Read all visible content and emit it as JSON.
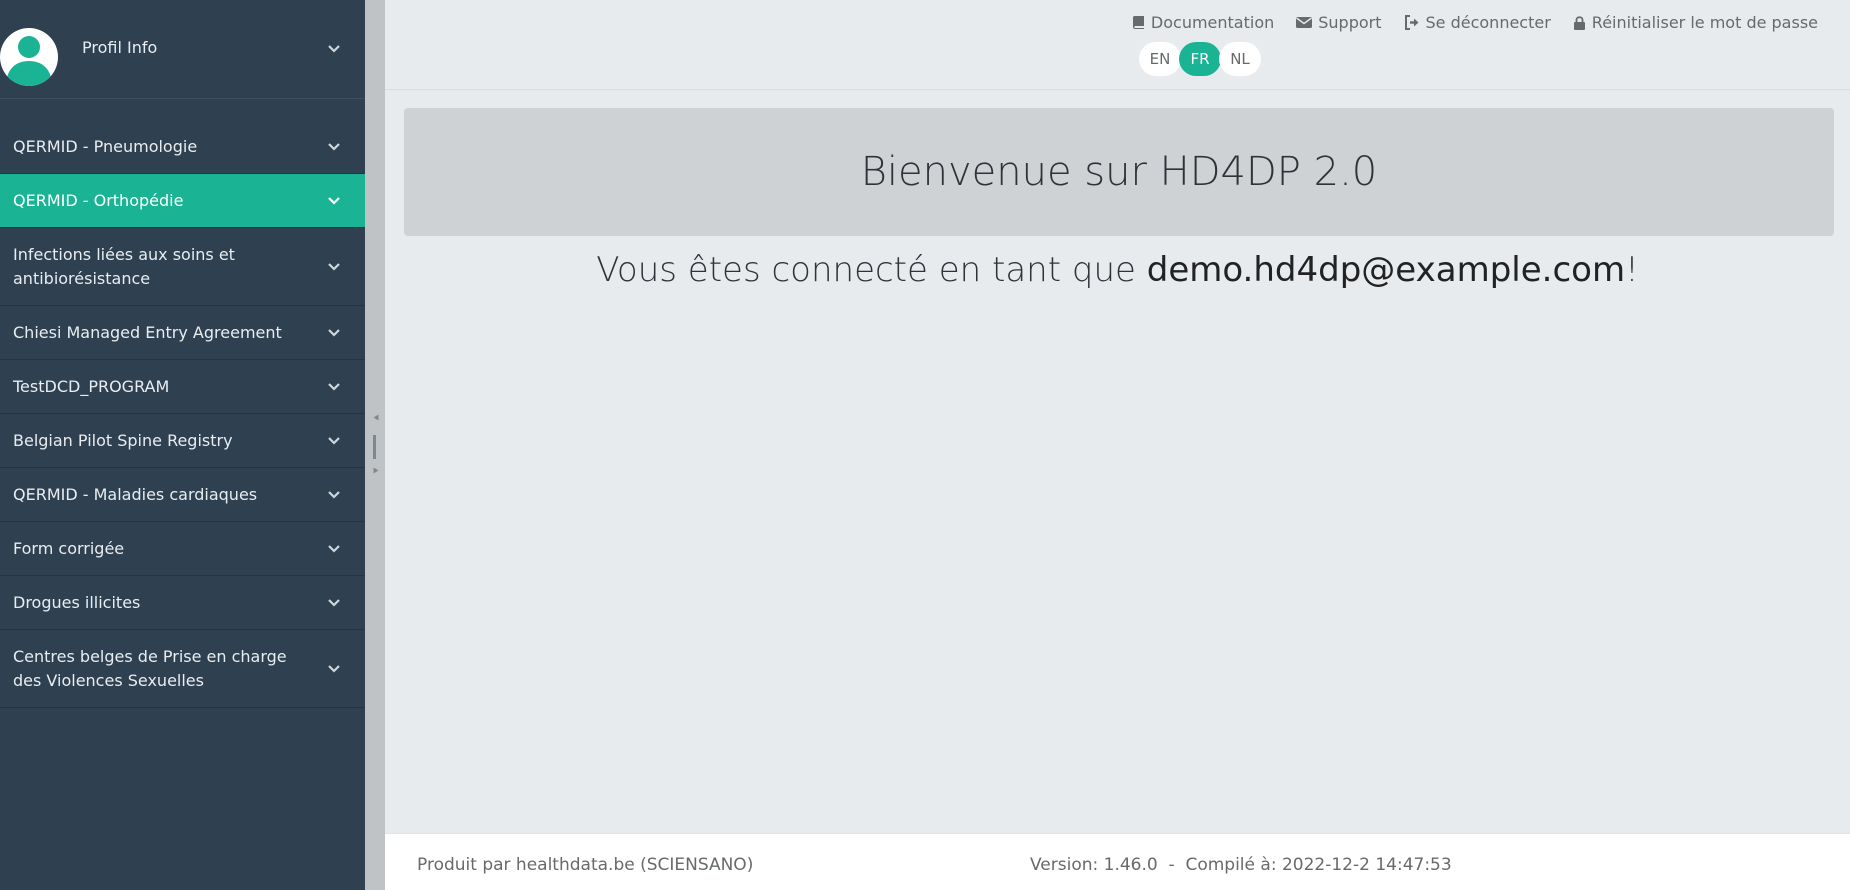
{
  "profile": {
    "label": "Profil Info"
  },
  "sidebar": {
    "items": [
      {
        "label": "QERMID - Pneumologie"
      },
      {
        "label": "QERMID - Orthopédie"
      },
      {
        "label": "Infections liées aux soins et antibiorésistance"
      },
      {
        "label": "Chiesi Managed Entry Agreement"
      },
      {
        "label": "TestDCD_PROGRAM"
      },
      {
        "label": "Belgian Pilot Spine Registry"
      },
      {
        "label": "QERMID - Maladies cardiaques"
      },
      {
        "label": "Form corrigée"
      },
      {
        "label": "Drogues illicites"
      },
      {
        "label": "Centres belges de Prise en charge des Violences Sexuelles"
      }
    ],
    "active_item": "QERMID - Orthopédie"
  },
  "header": {
    "links": {
      "documentation": "Documentation",
      "support": "Support",
      "logout": "Se déconnecter",
      "reset_password": "Réinitialiser le mot de passe"
    },
    "languages": [
      "EN",
      "FR",
      "NL"
    ],
    "active_language": "FR"
  },
  "main": {
    "welcome": "Bienvenue sur HD4DP 2.0",
    "connected_prefix": "Vous êtes connecté en tant que ",
    "email": "demo.hd4dp@example.com",
    "connected_suffix": "!"
  },
  "footer": {
    "producer": "Produit par healthdata.be (SCIENSANO)",
    "version": "Version: 1.46.0  -  Compilé à: 2022-12-2 14:47:53"
  },
  "colors": {
    "sidebar_bg": "#2f4050",
    "accent": "#1ab394",
    "content_bg": "#e8ebee"
  }
}
